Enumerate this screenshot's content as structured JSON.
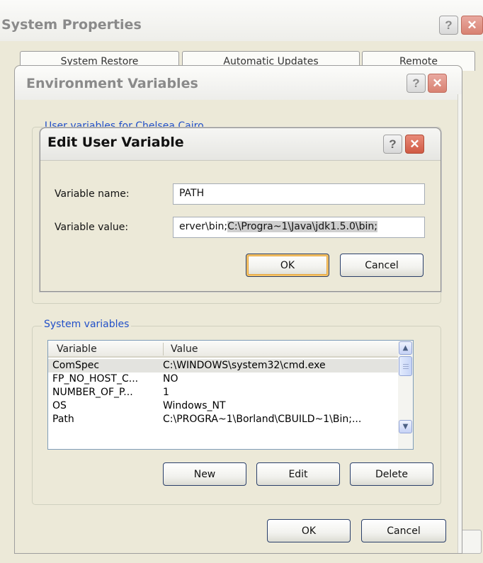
{
  "system_properties": {
    "title": "System Properties",
    "tabs": [
      "System Restore",
      "Automatic Updates",
      "Remote"
    ]
  },
  "environment_variables": {
    "title": "Environment Variables",
    "user_group_label": "User variables for Chelsea Cairo",
    "system_group_label": "System variables",
    "columns": {
      "variable": "Variable",
      "value": "Value"
    },
    "rows": [
      {
        "variable": "ComSpec",
        "value": "C:\\WINDOWS\\system32\\cmd.exe",
        "selected": true
      },
      {
        "variable": "FP_NO_HOST_C...",
        "value": "NO",
        "selected": false
      },
      {
        "variable": "NUMBER_OF_P...",
        "value": "1",
        "selected": false
      },
      {
        "variable": "OS",
        "value": "Windows_NT",
        "selected": false
      },
      {
        "variable": "Path",
        "value": "C:\\PROGRA~1\\Borland\\CBUILD~1\\Bin;...",
        "selected": false
      }
    ],
    "buttons": {
      "new": "New",
      "edit": "Edit",
      "delete": "Delete",
      "ok": "OK",
      "cancel": "Cancel"
    }
  },
  "edit_user_variable": {
    "title": "Edit User Variable",
    "name_label": "Variable name:",
    "name_value": "PATH",
    "value_label": "Variable value:",
    "value_plain": "erver\\bin;",
    "value_selected": "C:\\Progra~1\\Java\\jdk1.5.0\\bin;",
    "ok_label": "OK",
    "cancel_label": "Cancel"
  },
  "caption_glyphs": {
    "help": "?",
    "close": "✕"
  },
  "scroll_glyphs": {
    "up": "▲",
    "down": "▼"
  },
  "colors": {
    "group_label": "#2250c8",
    "dialog_bg": "#ece9d8",
    "close_btn": "#d88272"
  }
}
